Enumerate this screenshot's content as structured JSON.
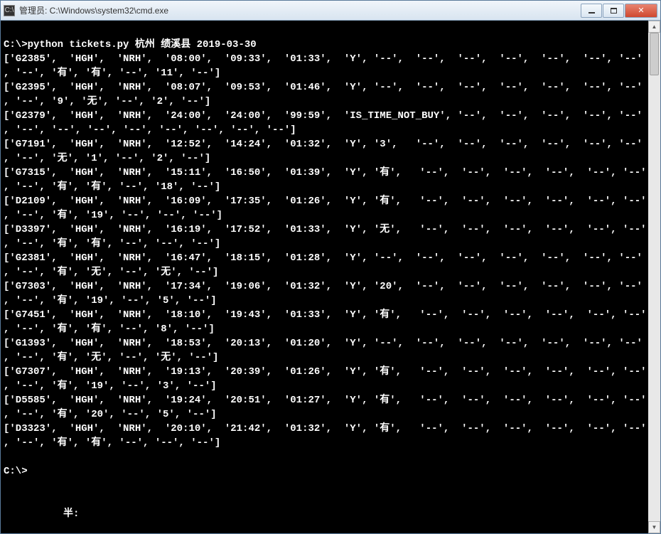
{
  "window": {
    "title": "管理员: C:\\Windows\\system32\\cmd.exe",
    "icon_label": "C:\\"
  },
  "command": {
    "prompt1": "C:\\>",
    "cmd": "python tickets.py 杭州 绩溪县 2019-03-30",
    "prompt2": "C:\\>"
  },
  "output_rows": [
    [
      "G2385",
      "HGH",
      "NRH",
      "08:00",
      "09:33",
      "01:33",
      "Y",
      "--",
      "--",
      "--",
      "--",
      "--",
      "--",
      "有",
      "有",
      "--",
      "11",
      "--"
    ],
    [
      "G2395",
      "HGH",
      "NRH",
      "08:07",
      "09:53",
      "01:46",
      "Y",
      "--",
      "--",
      "--",
      "--",
      "--",
      "--",
      "9",
      "无",
      "--",
      "2",
      "--"
    ],
    [
      "G2379",
      "HGH",
      "NRH",
      "24:00",
      "24:00",
      "99:59",
      "IS_TIME_NOT_BUY",
      "--",
      "--",
      "--",
      "--",
      "--",
      "--",
      "--",
      "--",
      "--",
      "--",
      "--"
    ],
    [
      "G7191",
      "HGH",
      "NRH",
      "12:52",
      "14:24",
      "01:32",
      "Y",
      "3",
      "--",
      "--",
      "--",
      "--",
      "--",
      "无",
      "1",
      "--",
      "2",
      "--"
    ],
    [
      "G7315",
      "HGH",
      "NRH",
      "15:11",
      "16:50",
      "01:39",
      "Y",
      "有",
      "--",
      "--",
      "--",
      "--",
      "--",
      "有",
      "有",
      "--",
      "18",
      "--"
    ],
    [
      "D2109",
      "HGH",
      "NRH",
      "16:09",
      "17:35",
      "01:26",
      "Y",
      "有",
      "--",
      "--",
      "--",
      "--",
      "--",
      "有",
      "19",
      "--",
      "--",
      "--"
    ],
    [
      "D3397",
      "HGH",
      "NRH",
      "16:19",
      "17:52",
      "01:33",
      "Y",
      "无",
      "--",
      "--",
      "--",
      "--",
      "--",
      "有",
      "有",
      "--",
      "--",
      "--"
    ],
    [
      "G2381",
      "HGH",
      "NRH",
      "16:47",
      "18:15",
      "01:28",
      "Y",
      "--",
      "--",
      "--",
      "--",
      "--",
      "--",
      "有",
      "无",
      "--",
      "无",
      "--"
    ],
    [
      "G7303",
      "HGH",
      "NRH",
      "17:34",
      "19:06",
      "01:32",
      "Y",
      "20",
      "--",
      "--",
      "--",
      "--",
      "--",
      "有",
      "19",
      "--",
      "5",
      "--"
    ],
    [
      "G7451",
      "HGH",
      "NRH",
      "18:10",
      "19:43",
      "01:33",
      "Y",
      "有",
      "--",
      "--",
      "--",
      "--",
      "--",
      "有",
      "有",
      "--",
      "8",
      "--"
    ],
    [
      "G1393",
      "HGH",
      "NRH",
      "18:53",
      "20:13",
      "01:20",
      "Y",
      "--",
      "--",
      "--",
      "--",
      "--",
      "--",
      "有",
      "无",
      "--",
      "无",
      "--"
    ],
    [
      "G7307",
      "HGH",
      "NRH",
      "19:13",
      "20:39",
      "01:26",
      "Y",
      "有",
      "--",
      "--",
      "--",
      "--",
      "--",
      "有",
      "19",
      "--",
      "3",
      "--"
    ],
    [
      "D5585",
      "HGH",
      "NRH",
      "19:24",
      "20:51",
      "01:27",
      "Y",
      "有",
      "--",
      "--",
      "--",
      "--",
      "--",
      "有",
      "20",
      "--",
      "5",
      "--"
    ],
    [
      "D3323",
      "HGH",
      "NRH",
      "20:10",
      "21:42",
      "01:32",
      "Y",
      "有",
      "--",
      "--",
      "--",
      "--",
      "--",
      "有",
      "有",
      "--",
      "--",
      "--"
    ]
  ],
  "footer_hint": "半:"
}
